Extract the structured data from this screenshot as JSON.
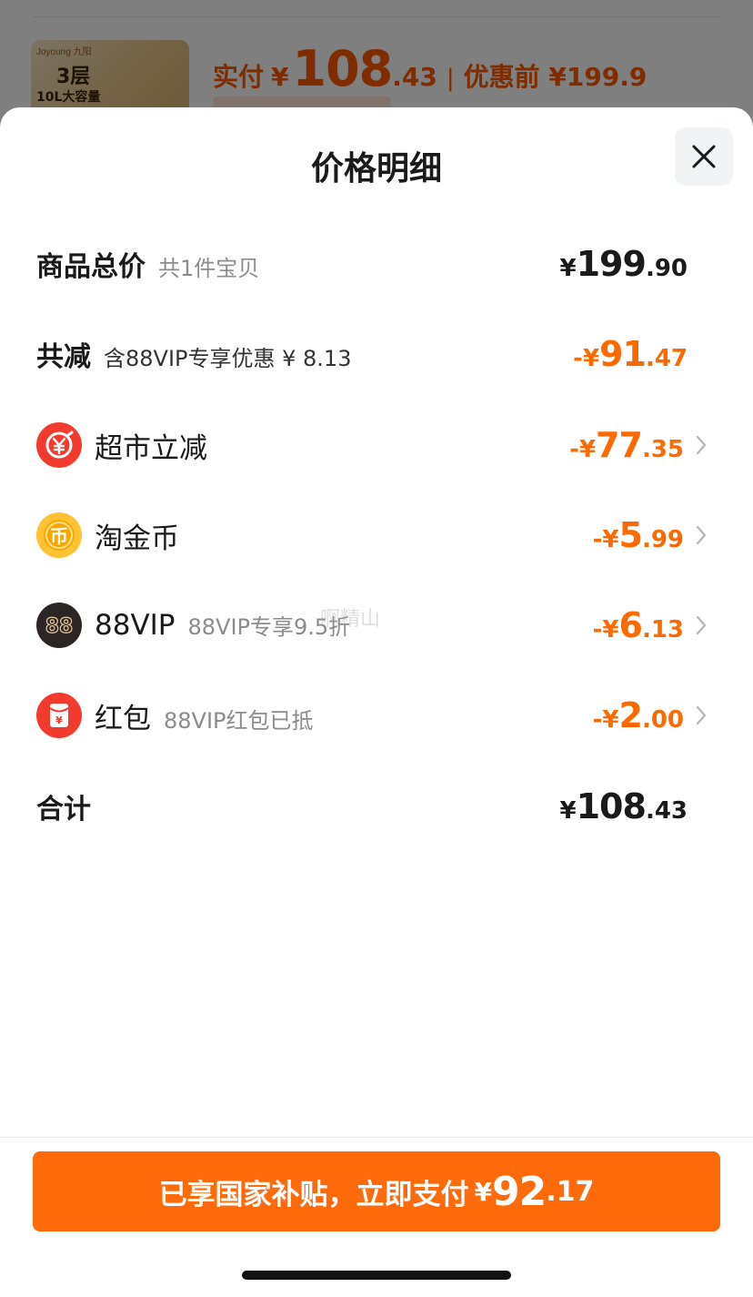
{
  "background_product": {
    "brand": "Joyoung 九阳",
    "thumb_line1": "3层",
    "thumb_line2": "10L大容量",
    "paid_label": "实付",
    "currency": "¥",
    "paid_int": "108",
    "paid_dec": ".43",
    "separator": "|",
    "orig_label": "优惠前 ¥199.9"
  },
  "sheet": {
    "title": "价格明细",
    "close_icon": "close-icon"
  },
  "total_price": {
    "label": "商品总价",
    "sub": "共1件宝贝",
    "prefix": "¥",
    "int": "199",
    "dec": ".90"
  },
  "total_discount": {
    "label": "共减",
    "sub": "含88VIP专享优惠 ¥ 8.13",
    "prefix": "-¥",
    "int": "91",
    "dec": ".47"
  },
  "discounts": [
    {
      "icon": "supermarket-discount-icon",
      "name": "超市立减",
      "sub": "",
      "prefix": "-¥",
      "int": "77",
      "dec": ".35"
    },
    {
      "icon": "tao-coin-icon",
      "name": "淘金币",
      "sub": "",
      "prefix": "-¥",
      "int": "5",
      "dec": ".99"
    },
    {
      "icon": "88vip-icon",
      "name": "88VIP",
      "sub": "88VIP专享9.5折",
      "prefix": "-¥",
      "int": "6",
      "dec": ".13"
    },
    {
      "icon": "red-packet-icon",
      "name": "红包",
      "sub": "88VIP红包已抵",
      "prefix": "-¥",
      "int": "2",
      "dec": ".00"
    }
  ],
  "sum": {
    "label": "合计",
    "prefix": "¥",
    "int": "108",
    "dec": ".43"
  },
  "pay_button": {
    "text": "已享国家补贴，立即支付",
    "prefix": "¥",
    "int": "92",
    "dec": ".17"
  },
  "watermark": "啊精山",
  "colors": {
    "accent": "#ff6a00",
    "button": "#ff6a0a",
    "text": "#1a1a1a",
    "muted": "#8c8c8c"
  }
}
